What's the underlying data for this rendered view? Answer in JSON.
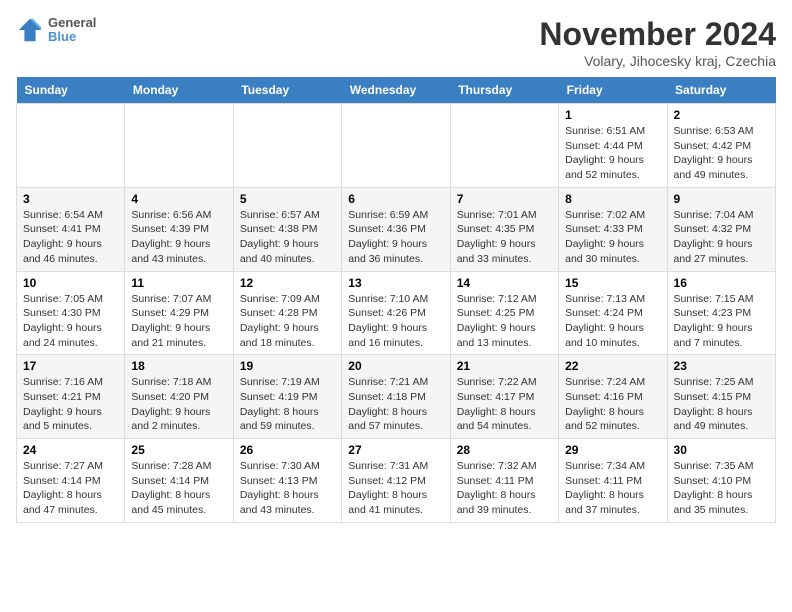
{
  "header": {
    "logo_text_line1": "General",
    "logo_text_line2": "Blue",
    "month_title": "November 2024",
    "location": "Volary, Jihocesky kraj, Czechia"
  },
  "weekdays": [
    "Sunday",
    "Monday",
    "Tuesday",
    "Wednesday",
    "Thursday",
    "Friday",
    "Saturday"
  ],
  "weeks": [
    [
      {
        "day": "",
        "info": ""
      },
      {
        "day": "",
        "info": ""
      },
      {
        "day": "",
        "info": ""
      },
      {
        "day": "",
        "info": ""
      },
      {
        "day": "",
        "info": ""
      },
      {
        "day": "1",
        "info": "Sunrise: 6:51 AM\nSunset: 4:44 PM\nDaylight: 9 hours and 52 minutes."
      },
      {
        "day": "2",
        "info": "Sunrise: 6:53 AM\nSunset: 4:42 PM\nDaylight: 9 hours and 49 minutes."
      }
    ],
    [
      {
        "day": "3",
        "info": "Sunrise: 6:54 AM\nSunset: 4:41 PM\nDaylight: 9 hours and 46 minutes."
      },
      {
        "day": "4",
        "info": "Sunrise: 6:56 AM\nSunset: 4:39 PM\nDaylight: 9 hours and 43 minutes."
      },
      {
        "day": "5",
        "info": "Sunrise: 6:57 AM\nSunset: 4:38 PM\nDaylight: 9 hours and 40 minutes."
      },
      {
        "day": "6",
        "info": "Sunrise: 6:59 AM\nSunset: 4:36 PM\nDaylight: 9 hours and 36 minutes."
      },
      {
        "day": "7",
        "info": "Sunrise: 7:01 AM\nSunset: 4:35 PM\nDaylight: 9 hours and 33 minutes."
      },
      {
        "day": "8",
        "info": "Sunrise: 7:02 AM\nSunset: 4:33 PM\nDaylight: 9 hours and 30 minutes."
      },
      {
        "day": "9",
        "info": "Sunrise: 7:04 AM\nSunset: 4:32 PM\nDaylight: 9 hours and 27 minutes."
      }
    ],
    [
      {
        "day": "10",
        "info": "Sunrise: 7:05 AM\nSunset: 4:30 PM\nDaylight: 9 hours and 24 minutes."
      },
      {
        "day": "11",
        "info": "Sunrise: 7:07 AM\nSunset: 4:29 PM\nDaylight: 9 hours and 21 minutes."
      },
      {
        "day": "12",
        "info": "Sunrise: 7:09 AM\nSunset: 4:28 PM\nDaylight: 9 hours and 18 minutes."
      },
      {
        "day": "13",
        "info": "Sunrise: 7:10 AM\nSunset: 4:26 PM\nDaylight: 9 hours and 16 minutes."
      },
      {
        "day": "14",
        "info": "Sunrise: 7:12 AM\nSunset: 4:25 PM\nDaylight: 9 hours and 13 minutes."
      },
      {
        "day": "15",
        "info": "Sunrise: 7:13 AM\nSunset: 4:24 PM\nDaylight: 9 hours and 10 minutes."
      },
      {
        "day": "16",
        "info": "Sunrise: 7:15 AM\nSunset: 4:23 PM\nDaylight: 9 hours and 7 minutes."
      }
    ],
    [
      {
        "day": "17",
        "info": "Sunrise: 7:16 AM\nSunset: 4:21 PM\nDaylight: 9 hours and 5 minutes."
      },
      {
        "day": "18",
        "info": "Sunrise: 7:18 AM\nSunset: 4:20 PM\nDaylight: 9 hours and 2 minutes."
      },
      {
        "day": "19",
        "info": "Sunrise: 7:19 AM\nSunset: 4:19 PM\nDaylight: 8 hours and 59 minutes."
      },
      {
        "day": "20",
        "info": "Sunrise: 7:21 AM\nSunset: 4:18 PM\nDaylight: 8 hours and 57 minutes."
      },
      {
        "day": "21",
        "info": "Sunrise: 7:22 AM\nSunset: 4:17 PM\nDaylight: 8 hours and 54 minutes."
      },
      {
        "day": "22",
        "info": "Sunrise: 7:24 AM\nSunset: 4:16 PM\nDaylight: 8 hours and 52 minutes."
      },
      {
        "day": "23",
        "info": "Sunrise: 7:25 AM\nSunset: 4:15 PM\nDaylight: 8 hours and 49 minutes."
      }
    ],
    [
      {
        "day": "24",
        "info": "Sunrise: 7:27 AM\nSunset: 4:14 PM\nDaylight: 8 hours and 47 minutes."
      },
      {
        "day": "25",
        "info": "Sunrise: 7:28 AM\nSunset: 4:14 PM\nDaylight: 8 hours and 45 minutes."
      },
      {
        "day": "26",
        "info": "Sunrise: 7:30 AM\nSunset: 4:13 PM\nDaylight: 8 hours and 43 minutes."
      },
      {
        "day": "27",
        "info": "Sunrise: 7:31 AM\nSunset: 4:12 PM\nDaylight: 8 hours and 41 minutes."
      },
      {
        "day": "28",
        "info": "Sunrise: 7:32 AM\nSunset: 4:11 PM\nDaylight: 8 hours and 39 minutes."
      },
      {
        "day": "29",
        "info": "Sunrise: 7:34 AM\nSunset: 4:11 PM\nDaylight: 8 hours and 37 minutes."
      },
      {
        "day": "30",
        "info": "Sunrise: 7:35 AM\nSunset: 4:10 PM\nDaylight: 8 hours and 35 minutes."
      }
    ]
  ]
}
